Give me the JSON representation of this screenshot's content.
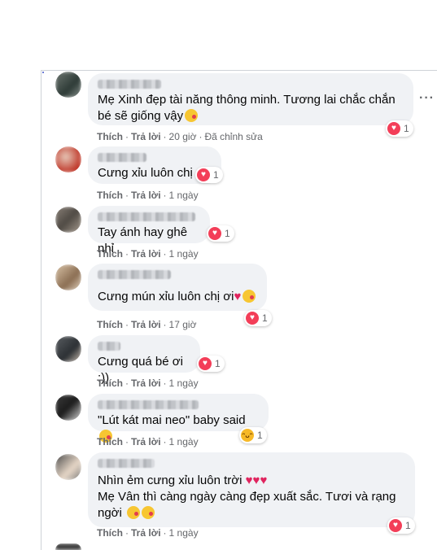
{
  "actions": {
    "like": "Thích",
    "reply": "Trả lời",
    "sep": "·"
  },
  "more_icon": "more-horizontal-icon",
  "comments": [
    {
      "text": "Mẹ Xinh đẹp tài năng thông minh. Tương lai chắc chắn bé sẽ giống vậy",
      "time": "20 giờ",
      "edited": "Đã chỉnh sửa",
      "reaction_count": "1",
      "reaction": "heart"
    },
    {
      "text": "Cưng xỉu luôn chị",
      "time": "1 ngày",
      "reaction_count": "1",
      "reaction": "heart"
    },
    {
      "text": "Tay ánh hay ghê nhỉ",
      "time": "1 ngày",
      "reaction_count": "1",
      "reaction": "heart"
    },
    {
      "text": "Cưng mún xỉu luôn chị ơi",
      "time": "17 giờ",
      "reaction_count": "1",
      "reaction": "heart"
    },
    {
      "text": "Cưng quá bé ơi :))",
      "time": "1 ngày",
      "reaction_count": "1",
      "reaction": "heart"
    },
    {
      "text": "\"Lút kát mai neo\" baby said",
      "time": "1 ngày",
      "reaction_count": "1",
      "reaction": "haha"
    },
    {
      "text": "Nhìn ẻm cưng xỉu luôn trời",
      "text2": "Mẹ Vân thì càng ngày càng đẹp xuất sắc. Tươi và rạng ngời",
      "time": "1 ngày",
      "reaction_count": "1",
      "reaction": "heart"
    }
  ],
  "colors": {
    "bubble": "#f0f2f5",
    "heart": "#f33e58",
    "haha": "#f7b928",
    "meta": "#65676b"
  }
}
